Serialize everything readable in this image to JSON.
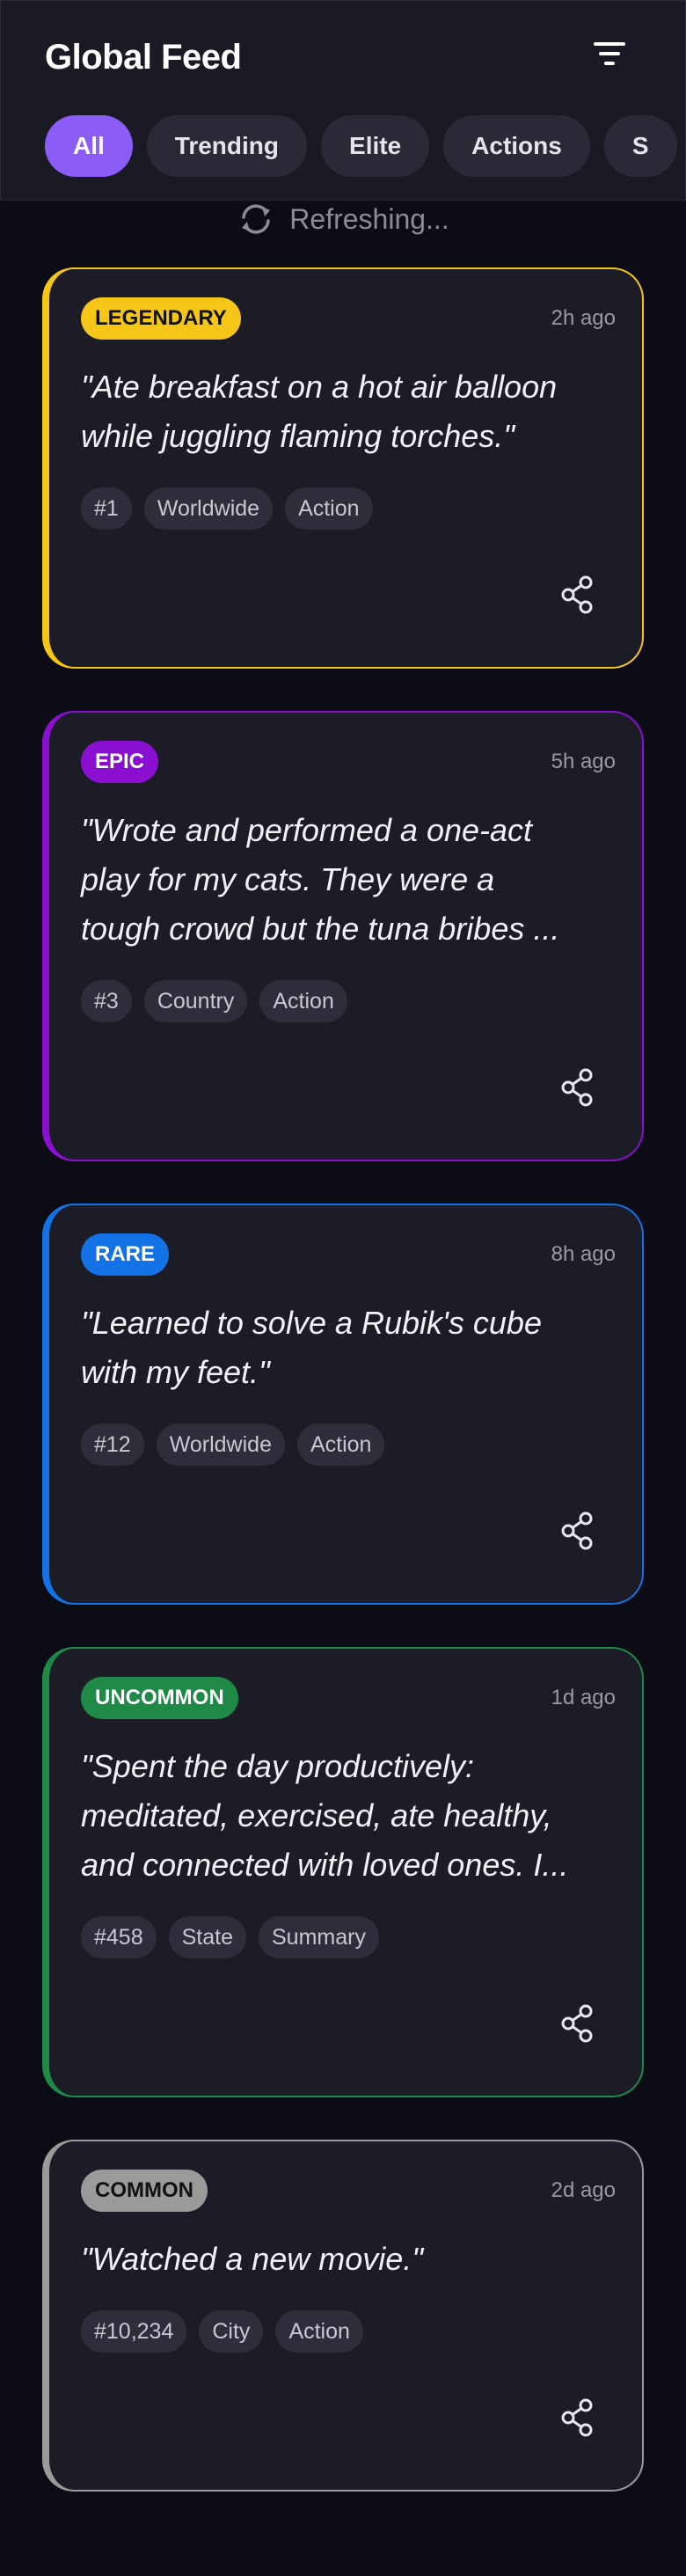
{
  "header": {
    "title": "Global Feed",
    "filter_icon": "filter-icon"
  },
  "filters": [
    "All",
    "Trending",
    "Elite",
    "Actions",
    "S"
  ],
  "active_filter": "All",
  "refresh": {
    "text": "Refreshing...",
    "icon": "refresh-icon"
  },
  "posts": [
    {
      "rarity": "LEGENDARY",
      "time": "2h ago",
      "quote": "\"Ate breakfast on a hot air balloon\nwhile juggling flaming torches.\"",
      "tags": [
        "#1",
        "Worldwide",
        "Action"
      ],
      "color": "#f5c518",
      "badge_text_color": "#111111",
      "share_icon": "share-icon"
    },
    {
      "rarity": "EPIC",
      "time": "5h ago",
      "quote": "\"Wrote and performed a one-act\nplay for my cats. They were a\ntough crowd but the tuna bribes ...",
      "tags": [
        "#3",
        "Country",
        "Action"
      ],
      "color": "#8a0fd1",
      "badge_text_color": "#ffffff",
      "share_icon": "share-icon"
    },
    {
      "rarity": "RARE",
      "time": "8h ago",
      "quote": "\"Learned to solve a Rubik's cube\nwith my feet.\"",
      "tags": [
        "#12",
        "Worldwide",
        "Action"
      ],
      "color": "#1372e6",
      "badge_text_color": "#ffffff",
      "share_icon": "share-icon"
    },
    {
      "rarity": "UNCOMMON",
      "time": "1d ago",
      "quote": "\"Spent the day productively:\nmeditated, exercised, ate healthy,\nand connected with loved ones. I...",
      "tags": [
        "#458",
        "State",
        "Summary"
      ],
      "color": "#1f8a47",
      "badge_text_color": "#ffffff",
      "share_icon": "share-icon"
    },
    {
      "rarity": "COMMON",
      "time": "2d ago",
      "quote": "\"Watched a new movie.\"",
      "tags": [
        "#10,234",
        "City",
        "Action"
      ],
      "color": "#9a9a9a",
      "badge_text_color": "#111111",
      "share_icon": "share-icon"
    }
  ]
}
